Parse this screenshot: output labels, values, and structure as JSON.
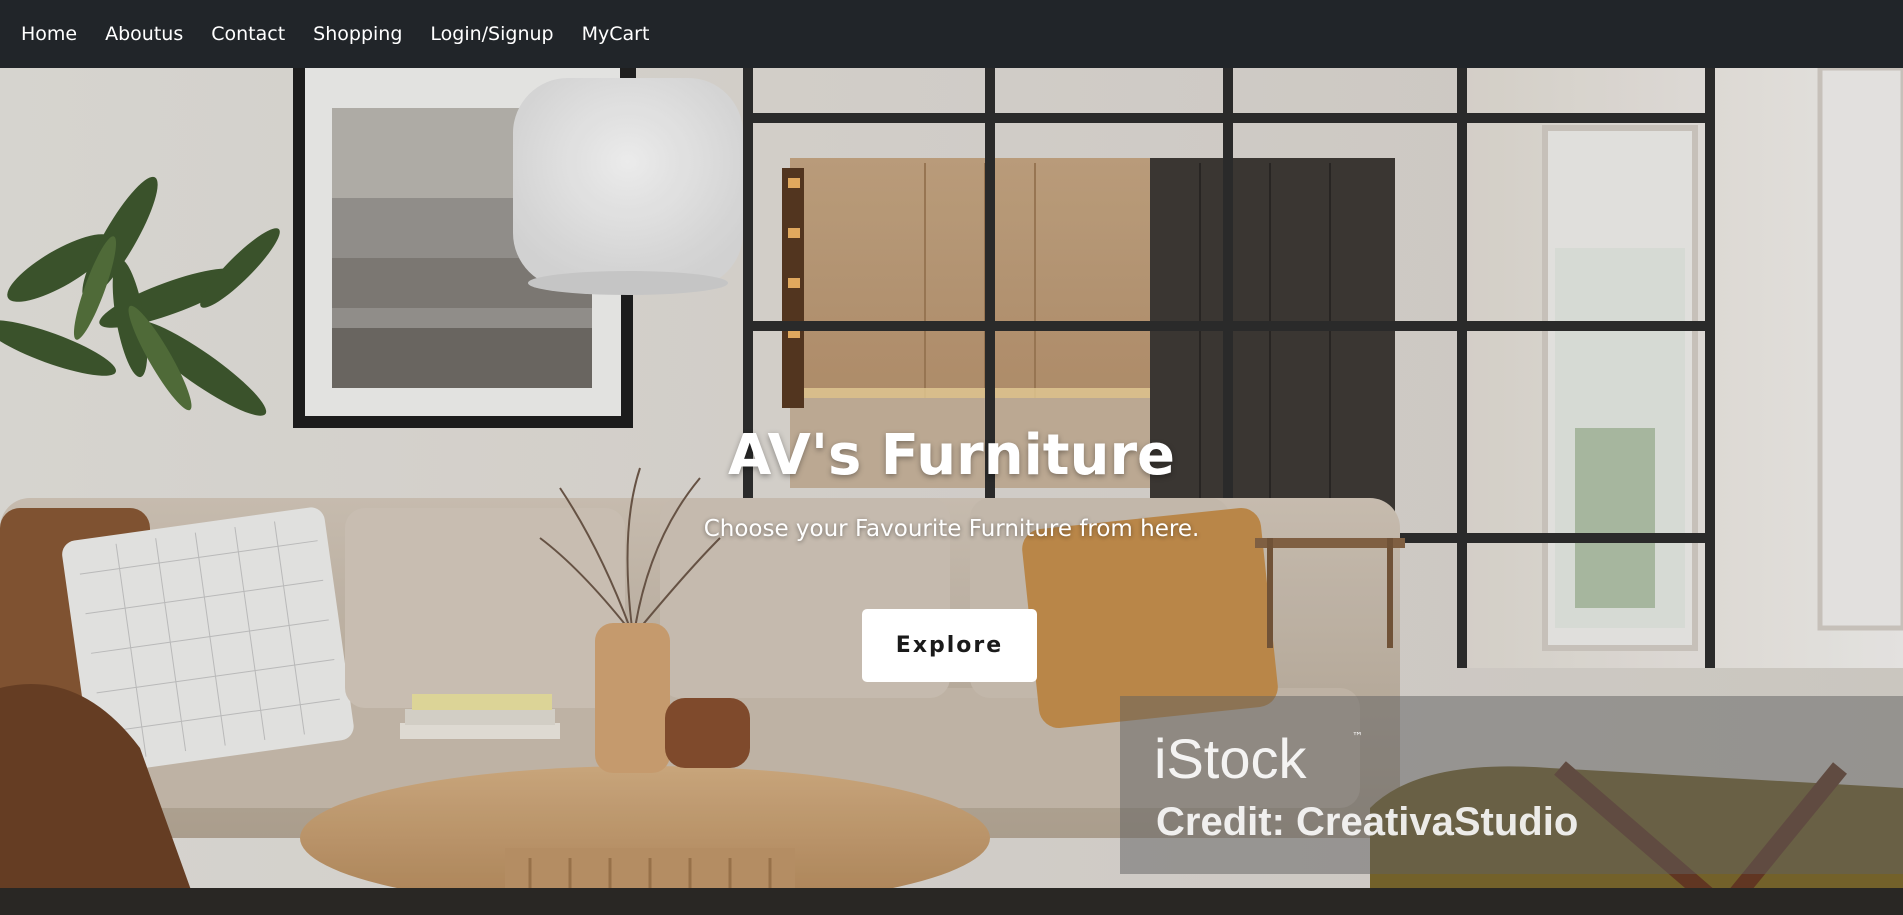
{
  "nav": {
    "items": [
      {
        "label": "Home"
      },
      {
        "label": "Aboutus"
      },
      {
        "label": "Contact"
      },
      {
        "label": "Shopping"
      },
      {
        "label": "Login/Signup"
      },
      {
        "label": "MyCart"
      }
    ]
  },
  "hero": {
    "title": "AV's Furniture",
    "subtitle": "Choose your Favourite Furniture from here.",
    "button_label": "Explore"
  },
  "watermark": {
    "brand": "iStock",
    "tm": "™",
    "credit": "Credit: CreativaStudio"
  },
  "colors": {
    "navbar": "#212529",
    "nav_text": "#ffffff",
    "button_bg": "#ffffff",
    "button_text": "#1a1a1a"
  }
}
